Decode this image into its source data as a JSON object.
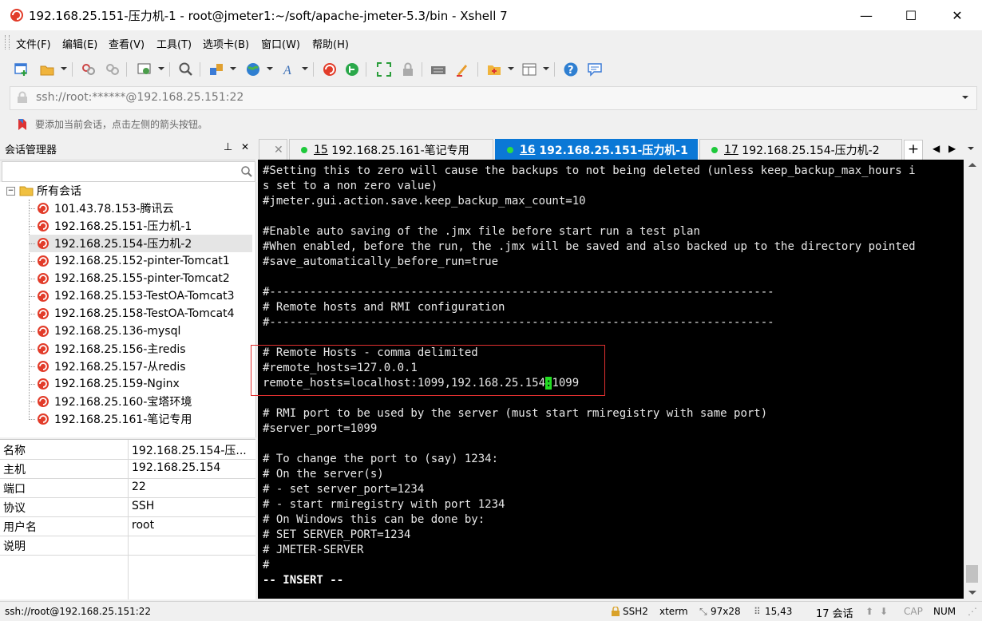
{
  "window": {
    "title": "192.168.25.151-压力机-1 - root@jmeter1:~/soft/apache-jmeter-5.3/bin - Xshell 7",
    "minimize_glyph": "—",
    "maximize_glyph": "☐",
    "close_glyph": "✕"
  },
  "menu": [
    "文件(F)",
    "编辑(E)",
    "查看(V)",
    "工具(T)",
    "选项卡(B)",
    "窗口(W)",
    "帮助(H)"
  ],
  "address": {
    "value": "ssh://root:******@192.168.25.151:22"
  },
  "hint": {
    "text": "要添加当前会话，点击左侧的箭头按钮。"
  },
  "session_manager": {
    "title": "会话管理器",
    "pin_glyph": "⊥",
    "close_glyph": "✕",
    "root": "所有会话",
    "sessions": [
      "101.43.78.153-腾讯云",
      "192.168.25.151-压力机-1",
      "192.168.25.154-压力机-2",
      "192.168.25.152-pinter-Tomcat1",
      "192.168.25.155-pinter-Tomcat2",
      "192.168.25.153-TestOA-Tomcat3",
      "192.168.25.158-TestOA-Tomcat4",
      "192.168.25.136-mysql",
      "192.168.25.156-主redis",
      "192.168.25.157-从redis",
      "192.168.25.159-Nginx",
      "192.168.25.160-宝塔环境",
      "192.168.25.161-笔记专用"
    ]
  },
  "properties": [
    {
      "key": "名称",
      "value": "192.168.25.154-压..."
    },
    {
      "key": "主机",
      "value": "192.168.25.154"
    },
    {
      "key": "端口",
      "value": "22"
    },
    {
      "key": "协议",
      "value": "SSH"
    },
    {
      "key": "用户名",
      "value": "root"
    },
    {
      "key": "说明",
      "value": ""
    }
  ],
  "tabs": [
    {
      "num": "15",
      "label": "192.168.25.161-笔记专用"
    },
    {
      "num": "16",
      "label": "192.168.25.151-压力机-1"
    },
    {
      "num": "17",
      "label": "192.168.25.154-压力机-2"
    }
  ],
  "tab_add_glyph": "+",
  "terminal": {
    "lines": [
      "#Setting this to zero will cause the backups to not being deleted (unless keep_backup_max_hours i",
      "s set to a non zero value)",
      "#jmeter.gui.action.save.keep_backup_max_count=10",
      "",
      "#Enable auto saving of the .jmx file before start run a test plan",
      "#When enabled, before the run, the .jmx will be saved and also backed up to the directory pointed",
      "#save_automatically_before_run=true",
      "",
      "#---------------------------------------------------------------------------",
      "# Remote hosts and RMI configuration",
      "#---------------------------------------------------------------------------",
      "",
      "# Remote Hosts - comma delimited",
      "#remote_hosts=127.0.0.1",
      "",
      "",
      "# RMI port to be used by the server (must start rmiregistry with same port)",
      "#server_port=1099",
      "",
      "# To change the port to (say) 1234:",
      "# On the server(s)",
      "# - set server_port=1234",
      "# - start rmiregistry with port 1234",
      "# On Windows this can be done by:",
      "# SET SERVER_PORT=1234",
      "# JMETER-SERVER",
      "#",
      "-- INSERT --"
    ],
    "cursor_line": {
      "before": "remote_hosts=localhost:1099,192.168.25.154",
      "cursor": ":",
      "after": "1099"
    }
  },
  "status": {
    "connection": "ssh://root@192.168.25.151:22",
    "protocol": "SSH2",
    "term": "xterm",
    "size": "97x28",
    "position": "15,43",
    "sessions": "17 会话",
    "cap": "CAP",
    "num": "NUM"
  },
  "colors": {
    "active_tab": "#0b78d6",
    "connected_dot": "#1ec93b",
    "highlight_border": "#e03030",
    "cursor": "#22dd22"
  }
}
